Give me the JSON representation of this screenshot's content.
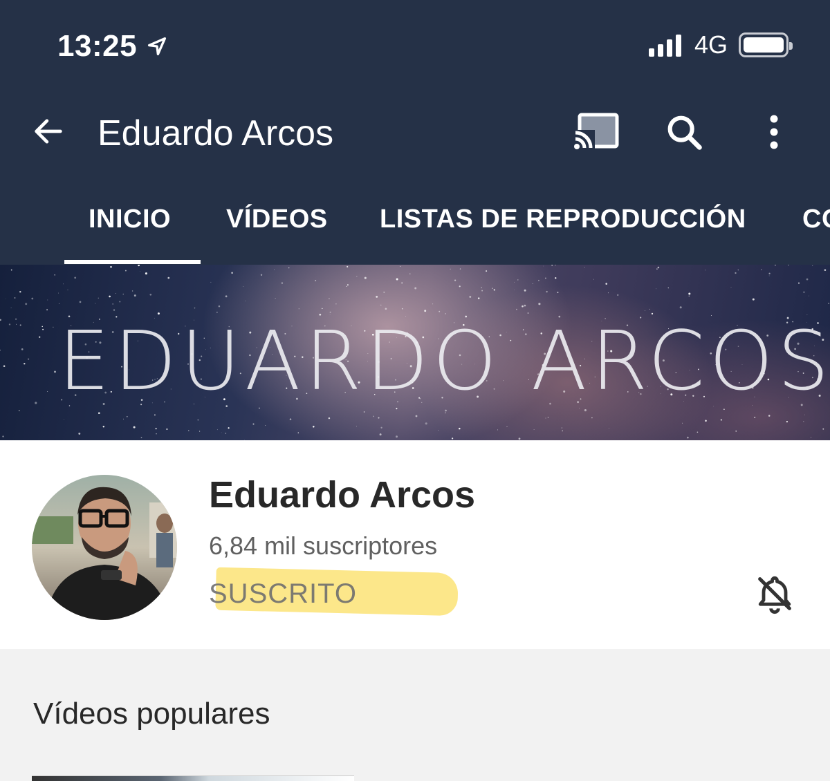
{
  "status_bar": {
    "time": "13:25",
    "network": "4G"
  },
  "app_bar": {
    "title": "Eduardo Arcos"
  },
  "tabs": [
    {
      "label": "INICIO",
      "active": true
    },
    {
      "label": "VÍDEOS",
      "active": false
    },
    {
      "label": "LISTAS DE REPRODUCCIÓN",
      "active": false
    },
    {
      "label": "CO",
      "active": false
    }
  ],
  "banner": {
    "text": "EDUARDO ARCOS"
  },
  "channel": {
    "name": "Eduardo Arcos",
    "subscribers": "6,84 mil suscriptores",
    "subscribe_state": "SUSCRITO"
  },
  "sections": {
    "popular_title": "Vídeos populares"
  },
  "colors": {
    "header": "#253147",
    "highlight": "#fad73c",
    "text_dark": "#282828",
    "text_muted": "#606060"
  },
  "icons": [
    "location-arrow-icon",
    "signal-icon",
    "battery-icon",
    "back-arrow-icon",
    "cast-icon",
    "search-icon",
    "more-vert-icon",
    "notifications-off-icon"
  ]
}
